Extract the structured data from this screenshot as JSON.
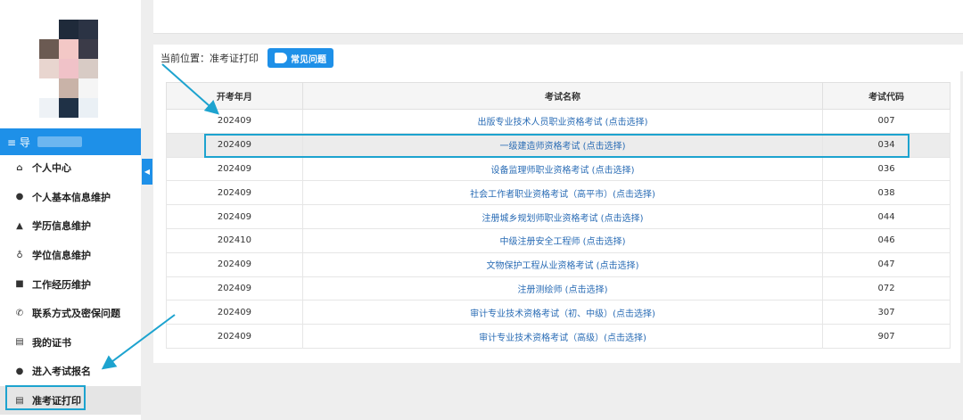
{
  "sidebar": {
    "header": "≡ 导",
    "items": [
      {
        "icon": "home-icon",
        "glyph": "⌂",
        "label": "个人中心"
      },
      {
        "icon": "user-icon",
        "glyph": "●",
        "label": "个人基本信息维护"
      },
      {
        "icon": "graduation-cap-icon",
        "glyph": "▲",
        "label": "学历信息维护"
      },
      {
        "icon": "degree-icon",
        "glyph": "♁",
        "label": "学位信息维护"
      },
      {
        "icon": "briefcase-icon",
        "glyph": "■",
        "label": "工作经历维护"
      },
      {
        "icon": "phone-icon",
        "glyph": "✆",
        "label": "联系方式及密保问题"
      },
      {
        "icon": "certificate-icon",
        "glyph": "▤",
        "label": "我的证书"
      },
      {
        "icon": "arrow-circle-icon",
        "glyph": "●",
        "label": "进入考试报名"
      },
      {
        "icon": "print-icon",
        "glyph": "▤",
        "label": "准考证打印"
      }
    ],
    "collapse_glyph": "◀"
  },
  "breadcrumb": {
    "label": "当前位置：准考证打印",
    "faq_button": "常见问题"
  },
  "table": {
    "headers": [
      "开考年月",
      "考试名称",
      "考试代码"
    ],
    "rows": [
      {
        "month": "202409",
        "name": "出版专业技术人员职业资格考试 (点击选择)",
        "code": "007"
      },
      {
        "month": "202409",
        "name": "一级建造师资格考试 (点击选择)",
        "code": "034"
      },
      {
        "month": "202409",
        "name": "设备监理师职业资格考试 (点击选择)",
        "code": "036"
      },
      {
        "month": "202409",
        "name": "社会工作者职业资格考试（高平市）(点击选择)",
        "code": "038"
      },
      {
        "month": "202409",
        "name": "注册城乡规划师职业资格考试 (点击选择)",
        "code": "044"
      },
      {
        "month": "202410",
        "name": "中级注册安全工程师 (点击选择)",
        "code": "046"
      },
      {
        "month": "202409",
        "name": "文物保护工程从业资格考试 (点击选择)",
        "code": "047"
      },
      {
        "month": "202409",
        "name": "注册测绘师 (点击选择)",
        "code": "072"
      },
      {
        "month": "202409",
        "name": "审计专业技术资格考试（初、中级）(点击选择)",
        "code": "307"
      },
      {
        "month": "202409",
        "name": "审计专业技术资格考试（高级）(点击选择)",
        "code": "907"
      }
    ],
    "highlighted_row": 1
  },
  "colors": {
    "accent": "#1e90e8",
    "annotation": "#1da3cf",
    "link": "#2a6cb5"
  }
}
